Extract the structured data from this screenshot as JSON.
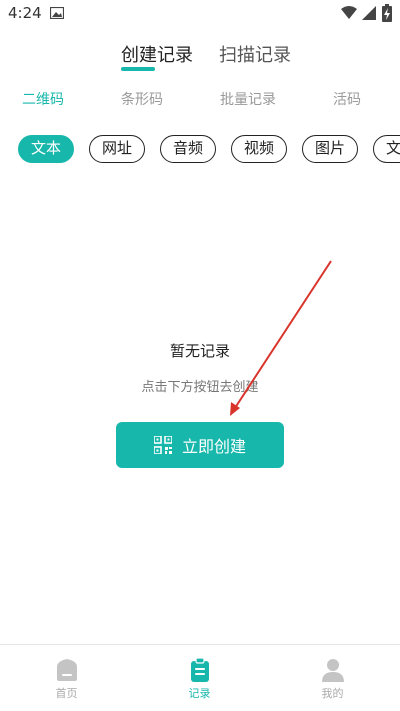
{
  "status_bar": {
    "time": "4:24"
  },
  "top_tabs": [
    {
      "label": "创建记录",
      "active": true
    },
    {
      "label": "扫描记录",
      "active": false
    }
  ],
  "sub_tabs": [
    {
      "label": "二维码",
      "active": true
    },
    {
      "label": "条形码",
      "active": false
    },
    {
      "label": "批量记录",
      "active": false
    },
    {
      "label": "活码",
      "active": false
    }
  ],
  "chips": [
    {
      "label": "文本",
      "active": true
    },
    {
      "label": "网址",
      "active": false
    },
    {
      "label": "音频",
      "active": false
    },
    {
      "label": "视频",
      "active": false
    },
    {
      "label": "图片",
      "active": false
    },
    {
      "label": "文",
      "active": false
    }
  ],
  "empty_state": {
    "title": "暂无记录",
    "subtitle": "点击下方按钮去创建",
    "button_label": "立即创建",
    "button_icon": "qr-code-icon"
  },
  "bottom_nav": [
    {
      "label": "首页",
      "icon": "home-icon",
      "active": false
    },
    {
      "label": "记录",
      "icon": "clipboard-icon",
      "active": true
    },
    {
      "label": "我的",
      "icon": "user-icon",
      "active": false
    }
  ],
  "colors": {
    "accent": "#18b7ab",
    "annotation_arrow": "#d9342b"
  }
}
